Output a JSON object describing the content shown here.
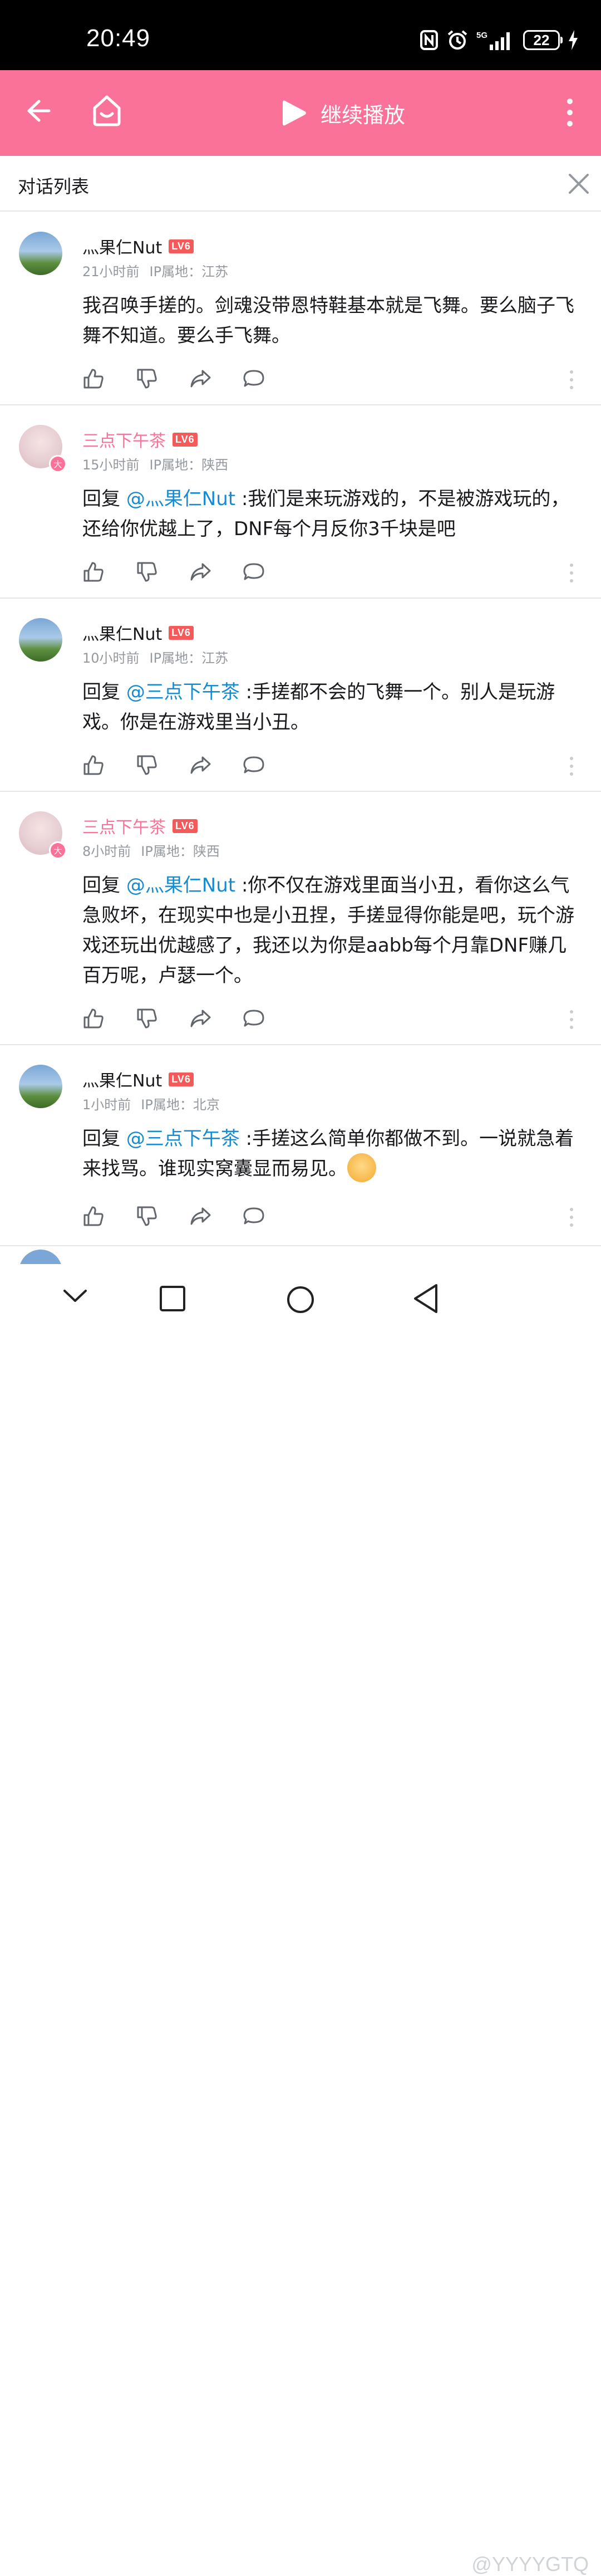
{
  "status_bar": {
    "time": "20:49",
    "battery": "22",
    "network": "5G"
  },
  "app_bar": {
    "continue_label": "继续播放"
  },
  "panel": {
    "title": "对话列表"
  },
  "comments": [
    {
      "user": "灬果仁Nut",
      "level": "LV6",
      "time": "21小时前",
      "ip": "IP属地：江苏",
      "reply_prefix": "",
      "mention": "",
      "text": "我召唤手搓的。剑魂没带恩特鞋基本就是飞舞。要么脑子飞舞不知道。要么手飞舞。"
    },
    {
      "user": "三点下午茶",
      "level": "LV6",
      "time": "15小时前",
      "ip": "IP属地：陕西",
      "reply_prefix": "回复 ",
      "mention": "@灬果仁Nut",
      "text": " :我们是来玩游戏的，不是被游戏玩的，还给你优越上了，DNF每个月反你3千块是吧"
    },
    {
      "user": "灬果仁Nut",
      "level": "LV6",
      "time": "10小时前",
      "ip": "IP属地：江苏",
      "reply_prefix": "回复 ",
      "mention": "@三点下午茶",
      "text": " :手搓都不会的飞舞一个。别人是玩游戏。你是在游戏里当小丑。"
    },
    {
      "user": "三点下午茶",
      "level": "LV6",
      "time": "8小时前",
      "ip": "IP属地：陕西",
      "reply_prefix": "回复 ",
      "mention": "@灬果仁Nut",
      "text": " :你不仅在游戏里面当小丑，看你这么气急败坏，在现实中也是小丑捏，手搓显得你能是吧，玩个游戏还玩出优越感了，我还以为你是aabb每个月靠DNF赚几百万呢，卢瑟一个。"
    },
    {
      "user": "灬果仁Nut",
      "level": "LV6",
      "time": "1小时前",
      "ip": "IP属地：北京",
      "reply_prefix": "回复 ",
      "mention": "@三点下午茶",
      "text": " :手搓这么简单你都做不到。一说就急着来找骂。谁现实窝囊显而易见。"
    }
  ],
  "watermark": "@YYYYGTQ",
  "colors": {
    "brand_pink": "#fb7299",
    "mention_blue": "#178bcf",
    "level_red": "#f45a5a"
  }
}
